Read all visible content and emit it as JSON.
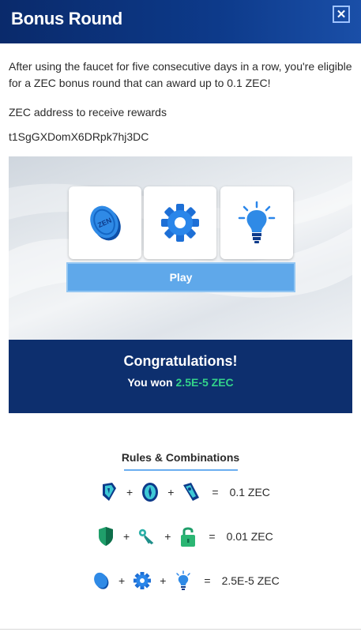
{
  "header": {
    "title": "Bonus Round",
    "close_label": "✕"
  },
  "intro": "After using the faucet for five consecutive days in a row, you're eligible for a ZEC bonus round that can award up to 0.1 ZEC!",
  "address": {
    "label": "ZEC address to receive rewards",
    "value": "t1SgGXDomX6DRpk7hj3DC"
  },
  "game": {
    "slots": [
      "coin-icon",
      "gear-icon",
      "lightbulb-icon"
    ],
    "coin_text": "ZEN",
    "play_label": "Play"
  },
  "result": {
    "title": "Congratulations!",
    "won_prefix": "You won",
    "amount": "2.5E-5 ZEC"
  },
  "rules": {
    "title": "Rules & Combinations",
    "combos": [
      {
        "icons": [
          "shield-tag-icon",
          "compass-icon",
          "pen-tag-icon"
        ],
        "reward": "0.1 ZEC"
      },
      {
        "icons": [
          "shield-icon",
          "key-icon",
          "padlock-icon"
        ],
        "reward": "0.01 ZEC"
      },
      {
        "icons": [
          "coin-icon",
          "gear-icon",
          "lightbulb-icon"
        ],
        "reward": "2.5E-5 ZEC"
      }
    ],
    "plus": "+",
    "equals": "="
  },
  "colors": {
    "header": "#0d3a8a",
    "result_bg": "#0d2f6e",
    "accent_green": "#33d38a",
    "play_button": "#5fa8ea"
  }
}
